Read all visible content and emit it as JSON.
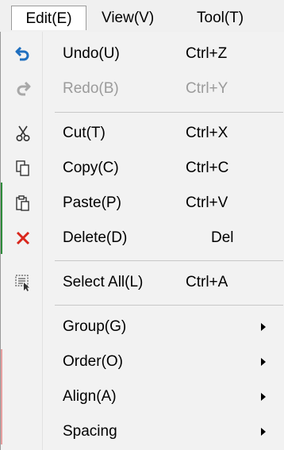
{
  "menubar": {
    "tabs": [
      {
        "label": "Edit(E)"
      },
      {
        "label": "View(V)"
      },
      {
        "label": "Tool(T)"
      }
    ]
  },
  "edit_menu": {
    "items": [
      {
        "label": "Undo(U)",
        "shortcut": "Ctrl+Z",
        "icon": "undo-icon",
        "enabled": true
      },
      {
        "label": "Redo(B)",
        "shortcut": "Ctrl+Y",
        "icon": "redo-icon",
        "enabled": false
      },
      {
        "label": "Cut(T)",
        "shortcut": "Ctrl+X",
        "icon": "scissors-icon",
        "enabled": true
      },
      {
        "label": "Copy(C)",
        "shortcut": "Ctrl+C",
        "icon": "copy-icon",
        "enabled": true
      },
      {
        "label": "Paste(P)",
        "shortcut": "Ctrl+V",
        "icon": "paste-icon",
        "enabled": true
      },
      {
        "label": "Delete(D)",
        "shortcut": "Del",
        "icon": "delete-x-icon",
        "enabled": true
      },
      {
        "label": "Select All(L)",
        "shortcut": "Ctrl+A",
        "icon": "select-all-icon",
        "enabled": true
      },
      {
        "label": "Group(G)",
        "submenu": true
      },
      {
        "label": "Order(O)",
        "submenu": true
      },
      {
        "label": "Align(A)",
        "submenu": true
      },
      {
        "label": "Spacing",
        "submenu": true
      }
    ]
  },
  "colors": {
    "undo_icon": "#1f6fbf",
    "delete_icon": "#d9261c",
    "disabled_text": "#9b9b9b"
  }
}
